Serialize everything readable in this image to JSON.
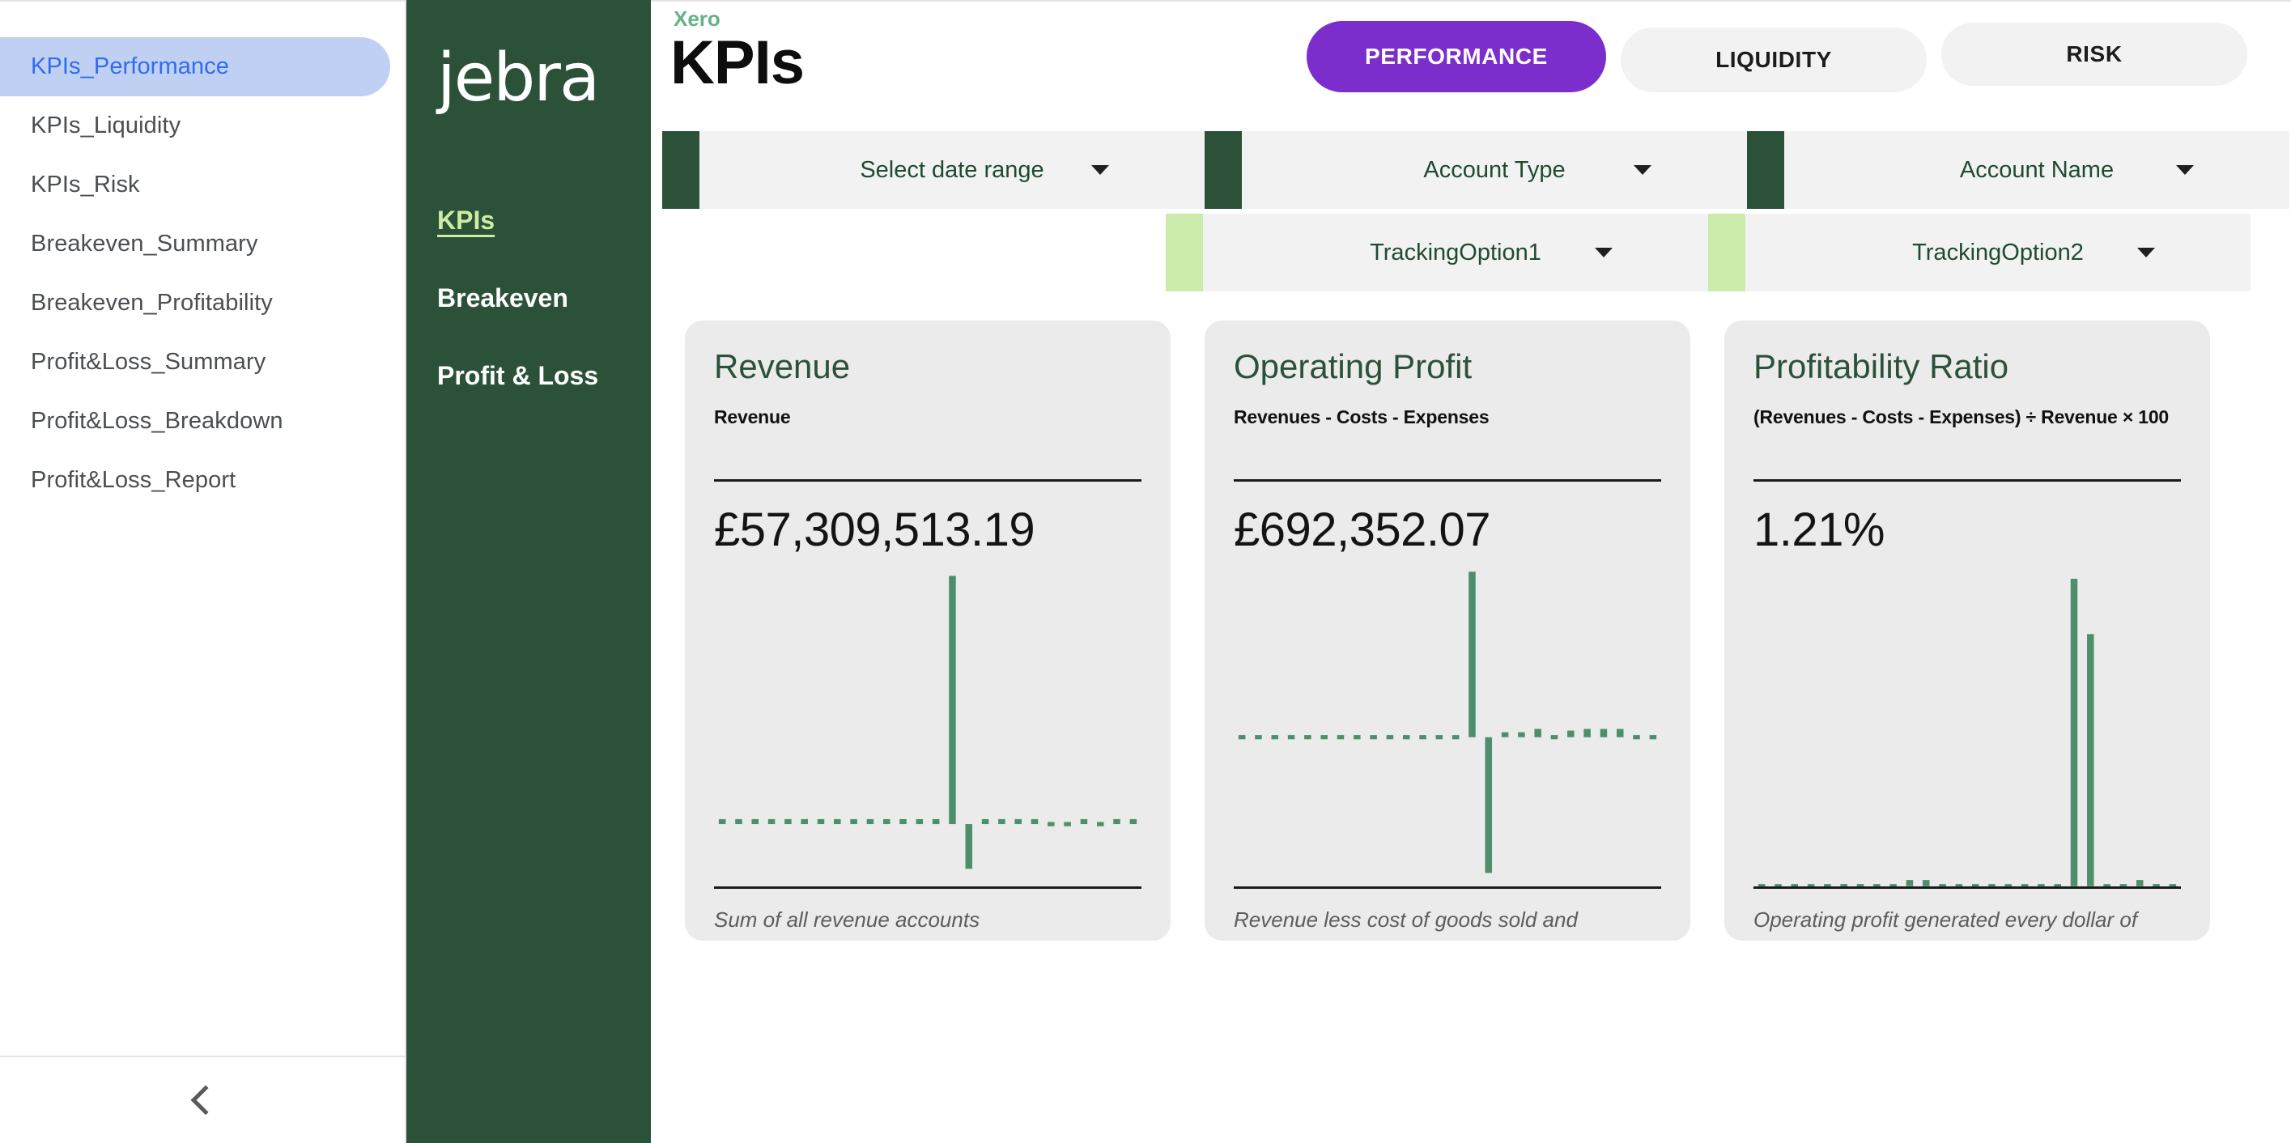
{
  "file_sidebar": {
    "items": [
      {
        "label": "KPIs_Performance",
        "active": true
      },
      {
        "label": "KPIs_Liquidity",
        "active": false
      },
      {
        "label": "KPIs_Risk",
        "active": false
      },
      {
        "label": "Breakeven_Summary",
        "active": false
      },
      {
        "label": "Breakeven_Profitability",
        "active": false
      },
      {
        "label": "Profit&Loss_Summary",
        "active": false
      },
      {
        "label": "Profit&Loss_Breakdown",
        "active": false
      },
      {
        "label": "Profit&Loss_Report",
        "active": false
      }
    ],
    "collapse_icon": "chevron-left-icon",
    "active_color": "#2f6df0",
    "active_bg": "#bfd0f2"
  },
  "brand_rail": {
    "logo": "jebra",
    "bg_color": "#2c5139",
    "links": [
      {
        "label": "KPIs",
        "current": true
      },
      {
        "label": "Breakeven",
        "current": false
      },
      {
        "label": "Profit & Loss",
        "current": false
      }
    ],
    "current_color": "#cdeda3"
  },
  "header": {
    "source_label": "Xero",
    "source_color": "#63b387",
    "title": "KPIs",
    "tabs": [
      {
        "label": "PERFORMANCE",
        "active": true
      },
      {
        "label": "LIQUIDITY",
        "active": false
      },
      {
        "label": "RISK",
        "active": false
      }
    ],
    "active_tab_color": "#7b2ecc"
  },
  "filters": {
    "row1": [
      {
        "label": "Select date range",
        "accent": "#2c5139",
        "icon": "chevron-down-icon"
      },
      {
        "label": "Account Type",
        "accent": "#2c5139",
        "icon": "chevron-down-icon"
      },
      {
        "label": "Account Name",
        "accent": "#2c5139",
        "icon": "chevron-down-icon"
      }
    ],
    "row2": [
      {
        "label": "TrackingOption1",
        "accent": "#ccecab",
        "icon": "chevron-down-icon"
      },
      {
        "label": "TrackingOption2",
        "accent": "#ccecab",
        "icon": "chevron-down-icon"
      }
    ]
  },
  "cards": [
    {
      "title": "Revenue",
      "formula": "Revenue",
      "value": "£57,309,513.19",
      "description": "Sum of all revenue accounts"
    },
    {
      "title": "Operating Profit",
      "formula": "Revenues - Costs - Expenses",
      "value": "£692,352.07",
      "description": "Revenue less cost of goods sold and"
    },
    {
      "title": "Profitability Ratio",
      "formula": "(Revenues - Costs - Expenses)  ÷ Revenue × 100",
      "value": "1.21%",
      "description": "Operating profit generated every dollar of"
    }
  ],
  "chart_data": [
    {
      "type": "bar",
      "title": "Revenue sparkline",
      "series_color": "#4d8f6c",
      "baseline": 0,
      "x": [
        1,
        2,
        3,
        4,
        5,
        6,
        7,
        8,
        9,
        10,
        11,
        12,
        13,
        14,
        15,
        16,
        17,
        18,
        19,
        20,
        21,
        22,
        23,
        24,
        25,
        26
      ],
      "values": [
        0.02,
        0.02,
        0.02,
        0.02,
        0.02,
        0.02,
        0.02,
        0.02,
        0.02,
        0.02,
        0.02,
        0.02,
        0.02,
        0.02,
        1.0,
        -0.18,
        0.02,
        0.02,
        0.02,
        0.02,
        0.015,
        0.012,
        0.02,
        0.01,
        0.02,
        0.02
      ],
      "ylim": [
        -0.25,
        1.05
      ],
      "grid": false,
      "legend": "none"
    },
    {
      "type": "bar",
      "title": "Operating Profit sparkline",
      "series_color": "#4d8f6c",
      "baseline": 0,
      "x": [
        1,
        2,
        3,
        4,
        5,
        6,
        7,
        8,
        9,
        10,
        11,
        12,
        13,
        14,
        15,
        16,
        17,
        18,
        19,
        20,
        21,
        22,
        23,
        24,
        25,
        26
      ],
      "values": [
        0.02,
        0.02,
        0.02,
        0.02,
        0.02,
        0.02,
        0.02,
        0.02,
        0.02,
        0.02,
        0.02,
        0.02,
        0.02,
        0.02,
        1.0,
        -0.82,
        0.03,
        0.03,
        0.05,
        0.02,
        0.04,
        0.05,
        0.05,
        0.05,
        0.02,
        0.02
      ],
      "ylim": [
        -0.9,
        1.05
      ],
      "grid": false,
      "legend": "none"
    },
    {
      "type": "bar",
      "title": "Profitability Ratio sparkline",
      "series_color": "#4d8f6c",
      "baseline": 0,
      "x": [
        1,
        2,
        3,
        4,
        5,
        6,
        7,
        8,
        9,
        10,
        11,
        12,
        13,
        14,
        15,
        16,
        17,
        18,
        19,
        20,
        21,
        22,
        23,
        24,
        25,
        26
      ],
      "values": [
        0,
        0,
        0,
        0,
        0,
        0,
        0,
        0,
        0,
        0.02,
        0.02,
        0,
        0,
        0,
        0,
        0,
        0,
        0,
        0,
        1.0,
        0.82,
        0,
        0,
        0.02,
        0,
        0
      ],
      "ylim": [
        0,
        1.05
      ],
      "grid": false,
      "legend": "none"
    }
  ]
}
